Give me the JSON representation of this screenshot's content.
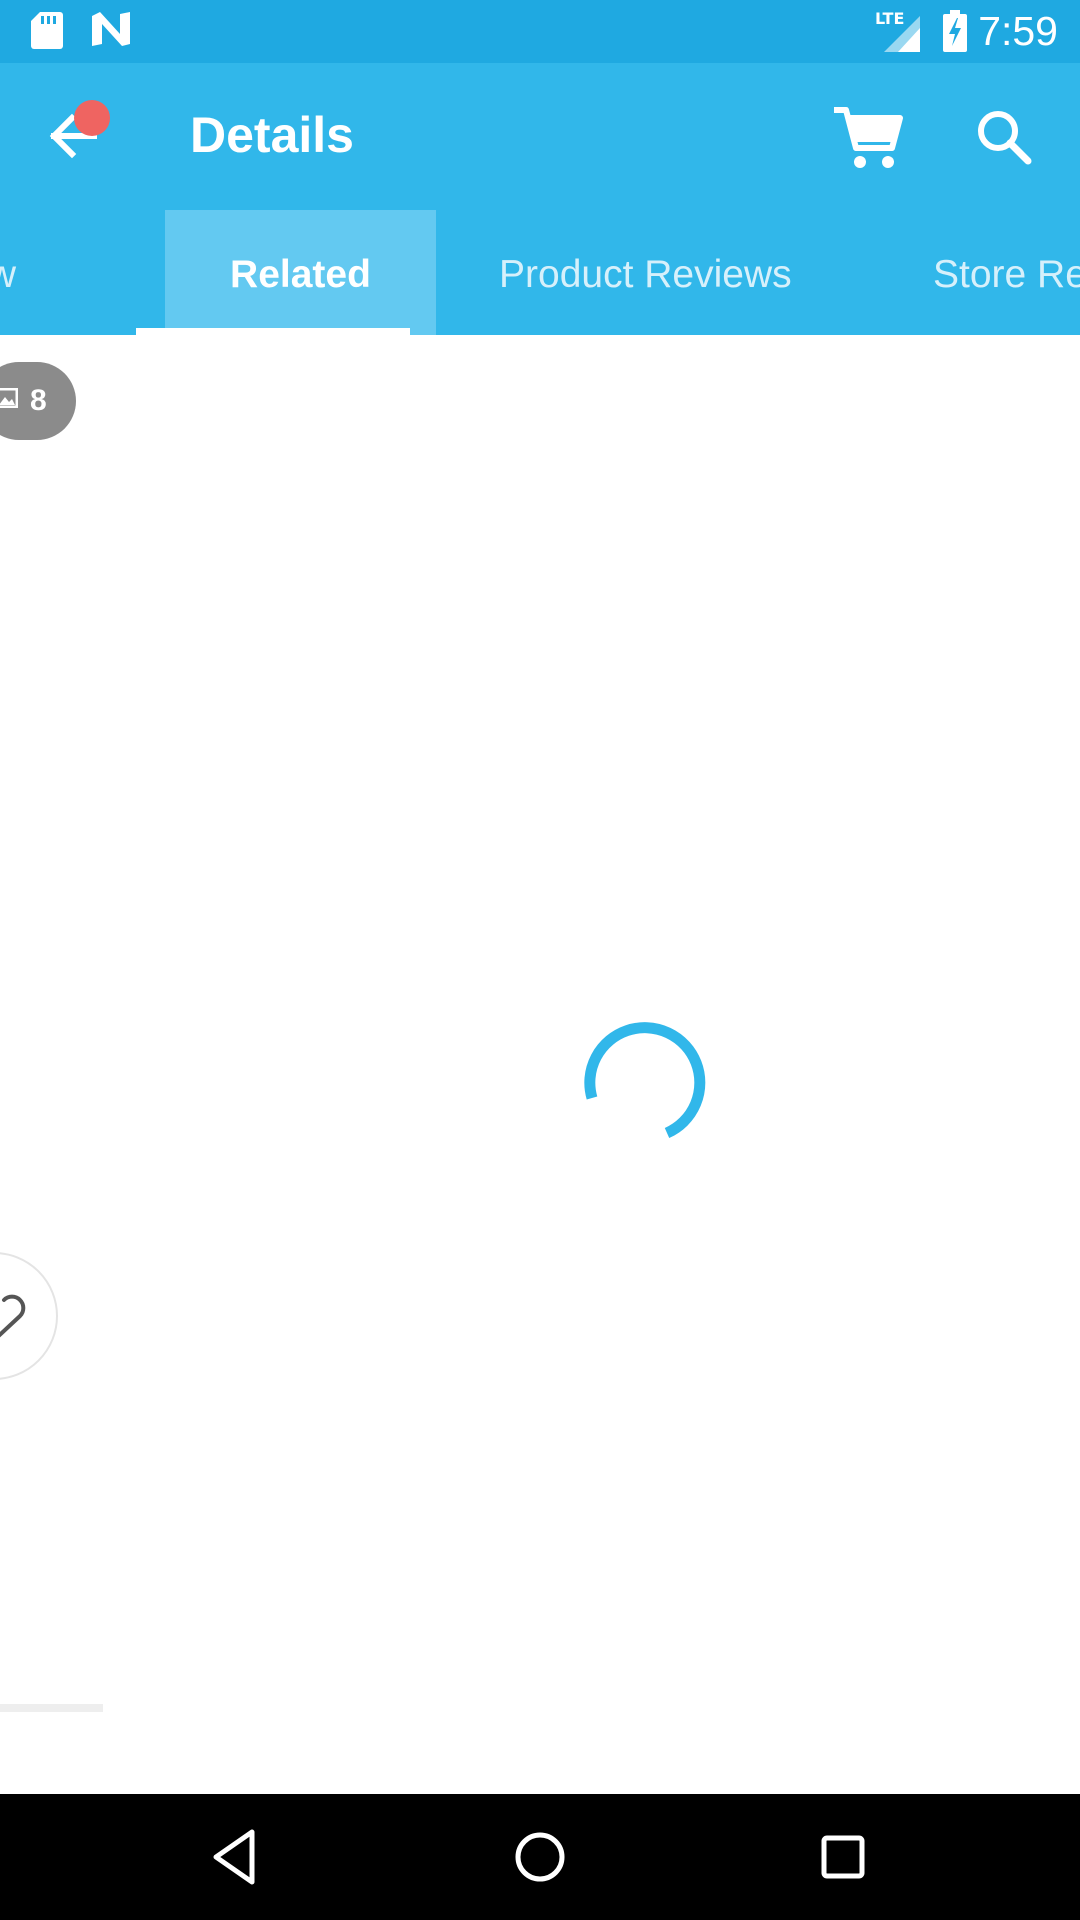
{
  "status_bar": {
    "time": "7:59",
    "network": "LTE",
    "icons": [
      "sd-card-icon",
      "notification-n-icon",
      "lte-signal-icon",
      "battery-charging-icon"
    ]
  },
  "app_bar": {
    "title": "Details",
    "icons": [
      "back-arrow-icon",
      "cart-icon",
      "search-icon"
    ]
  },
  "tabs": [
    {
      "label": "Overview",
      "visible_text": "rview",
      "selected": false
    },
    {
      "label": "Related",
      "visible_text": "Related",
      "selected": true
    },
    {
      "label": "Product Reviews",
      "visible_text": "Product Reviews",
      "selected": false
    },
    {
      "label": "Store Reviews",
      "visible_text": "Store Re",
      "selected": false
    }
  ],
  "content": {
    "photo_count": "8",
    "loading": true,
    "spinner_icon": "loading-spinner-icon",
    "favorite_icon": "heart-outline-icon"
  },
  "nav_bar": {
    "icons": [
      "nav-back-icon",
      "nav-home-icon",
      "nav-recents-icon"
    ]
  },
  "colors": {
    "status_bar": "#1fa9e1",
    "app_bar": "#31b7ea",
    "selected_tab_bg": "#63c9f1",
    "accent": "#31b7ea",
    "notification_dot": "#ef6461",
    "badge_bg": "#8b8b8b"
  }
}
